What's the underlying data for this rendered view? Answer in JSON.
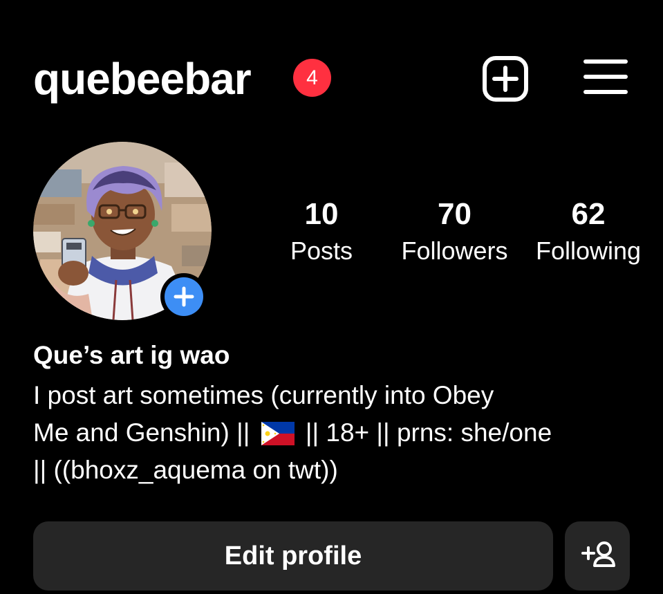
{
  "header": {
    "username": "quebeebar",
    "notification_count": "4",
    "icons": {
      "new_post": "plus-square-icon",
      "menu": "hamburger-menu-icon"
    }
  },
  "profile": {
    "avatar_icon": "profile-avatar",
    "add_story_icon": "plus-icon",
    "stats": [
      {
        "value": "10",
        "label": "Posts"
      },
      {
        "value": "70",
        "label": "Followers"
      },
      {
        "value": "62",
        "label": "Following"
      }
    ]
  },
  "bio": {
    "name": "Que’s art ig wao",
    "line1": "I post art sometimes (currently into Obey",
    "line2_before_flag": "Me and Genshin) ||",
    "flag_icon": "philippines-flag-icon",
    "line2_after_flag": "|| 18+ || prns: she/one",
    "line3": "|| ((bhoxz_aquema on twt))"
  },
  "actions": {
    "edit_profile_label": "Edit profile",
    "discover_people_icon": "add-person-icon"
  },
  "colors": {
    "background": "#000000",
    "badge_red": "#ff3040",
    "story_blue": "#3d8ef5",
    "button_gray": "#262626"
  }
}
